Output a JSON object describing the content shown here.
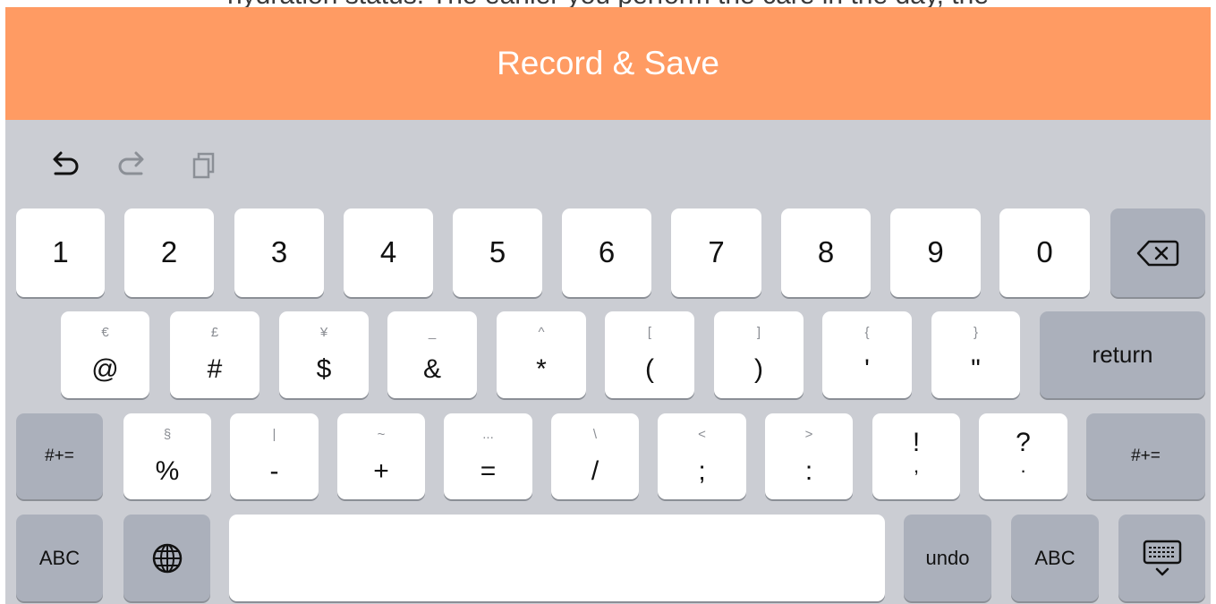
{
  "background_text": "hydration status. The earlier you perform the care in the day, the",
  "record_button": {
    "label": "Record & Save"
  },
  "shortcuts": {
    "undo_icon": "undo-arrow-icon",
    "redo_icon": "redo-arrow-icon",
    "paste_icon": "paste-clipboard-icon"
  },
  "keyboard": {
    "row1": [
      "1",
      "2",
      "3",
      "4",
      "5",
      "6",
      "7",
      "8",
      "9",
      "0"
    ],
    "row1_delete_icon": "delete-backspace-icon",
    "row2": [
      {
        "main": "@",
        "alt": "€"
      },
      {
        "main": "#",
        "alt": "£"
      },
      {
        "main": "$",
        "alt": "¥"
      },
      {
        "main": "&",
        "alt": "_"
      },
      {
        "main": "*",
        "alt": "^"
      },
      {
        "main": "(",
        "alt": "["
      },
      {
        "main": ")",
        "alt": "]"
      },
      {
        "main": "'",
        "alt": "{"
      },
      {
        "main": "\"",
        "alt": "}"
      }
    ],
    "return_label": "return",
    "symbols_label": "#+=",
    "row3": [
      {
        "main": "%",
        "alt": "§"
      },
      {
        "main": "-",
        "alt": "|"
      },
      {
        "main": "+",
        "alt": "~"
      },
      {
        "main": "=",
        "alt": "..."
      },
      {
        "main": "/",
        "alt": "\\"
      },
      {
        "main": ";",
        "alt": "<"
      },
      {
        "main": ":",
        "alt": ">"
      },
      {
        "main": "!",
        "alt": ","
      },
      {
        "main": "?",
        "alt": "."
      }
    ],
    "abc_label": "ABC",
    "globe_icon": "globe-icon",
    "space_label": "",
    "undo_label": "undo",
    "dismiss_icon": "keyboard-dismiss-icon"
  }
}
